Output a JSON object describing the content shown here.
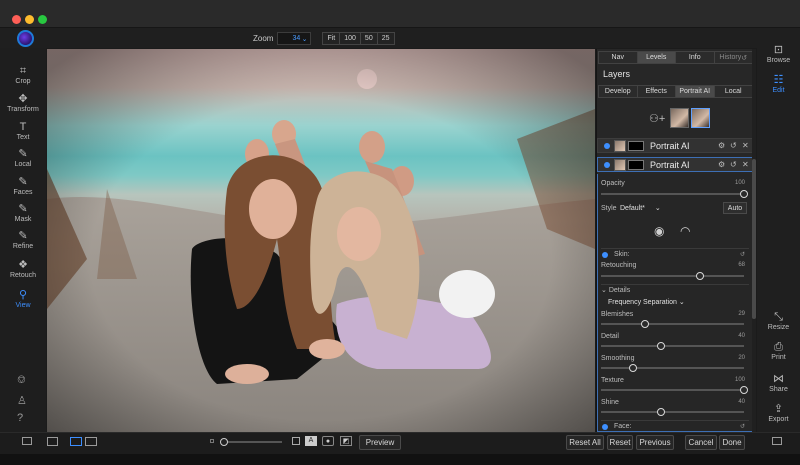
{
  "zoom": {
    "label": "Zoom",
    "value": "34",
    "presets": [
      "Fit",
      "100",
      "50",
      "25"
    ]
  },
  "left_tools": [
    {
      "label": "Crop",
      "icon": "crop-icon",
      "glyph": "⌗"
    },
    {
      "label": "Transform",
      "icon": "transform-icon",
      "glyph": "✥"
    },
    {
      "label": "Text",
      "icon": "text-icon",
      "glyph": "T"
    },
    {
      "label": "Local",
      "icon": "brush-icon",
      "glyph": "✎"
    },
    {
      "label": "Faces",
      "icon": "faces-icon",
      "glyph": "✎"
    },
    {
      "label": "Mask",
      "icon": "mask-icon",
      "glyph": "✎"
    },
    {
      "label": "Refine",
      "icon": "refine-icon",
      "glyph": "✎"
    },
    {
      "label": "Retouch",
      "icon": "retouch-icon",
      "glyph": "❖"
    },
    {
      "label": "View",
      "icon": "view-icon",
      "glyph": "⚲"
    }
  ],
  "right_tools": [
    {
      "label": "Browse",
      "icon": "browse-icon",
      "glyph": "⊡"
    },
    {
      "label": "Edit",
      "icon": "edit-icon",
      "glyph": "☷"
    },
    {
      "label": "Resize",
      "icon": "resize-icon",
      "glyph": "⤡"
    },
    {
      "label": "Print",
      "icon": "print-icon",
      "glyph": "⎙"
    },
    {
      "label": "Share",
      "icon": "share-icon",
      "glyph": "⋈"
    },
    {
      "label": "Export",
      "icon": "export-icon",
      "glyph": "⇪"
    }
  ],
  "panel": {
    "tabs": [
      "Nav",
      "Levels",
      "Info",
      "History"
    ],
    "title": "Layers",
    "subtabs": [
      "Develop",
      "Effects",
      "Portrait AI",
      "Local"
    ],
    "layers": [
      {
        "name": "Portrait AI"
      },
      {
        "name": "Portrait AI"
      }
    ],
    "opacity": {
      "label": "Opacity",
      "value": "100"
    },
    "style": {
      "label": "Style",
      "value": "Default*",
      "auto": "Auto"
    },
    "skin": {
      "label": "Skin:",
      "retouching_label": "Retouching",
      "retouching_value": "68"
    },
    "details": {
      "label": "Details",
      "mode": "Frequency Separation"
    },
    "sliders": [
      {
        "label": "Blemishes",
        "value": "29"
      },
      {
        "label": "Detail",
        "value": "40"
      },
      {
        "label": "Smoothing",
        "value": "20"
      },
      {
        "label": "Texture",
        "value": "100"
      },
      {
        "label": "Shine",
        "value": "40"
      }
    ],
    "face": {
      "label": "Face:"
    }
  },
  "bottom": {
    "preview": "Preview",
    "reset_all": "Reset All",
    "reset": "Reset",
    "previous": "Previous",
    "cancel": "Cancel",
    "done": "Done"
  },
  "colors": {
    "accent": "#3d8fff",
    "panel": "#272727",
    "background": "#1b1b1b"
  }
}
